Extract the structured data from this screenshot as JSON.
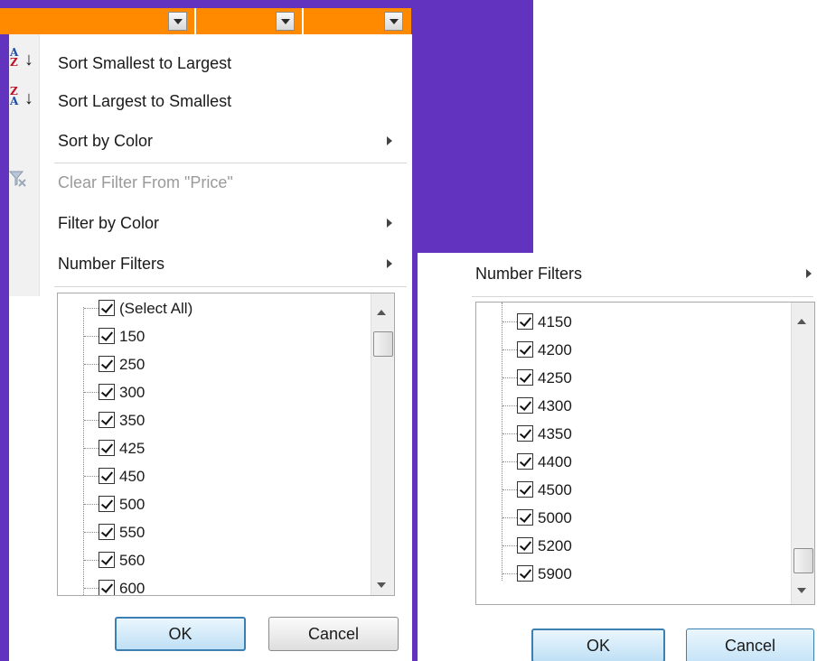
{
  "colors": {
    "background_purple": "#6233bf",
    "header_orange": "#ff8a00",
    "ok_border": "#3c7fb1"
  },
  "header": {
    "dropdown_icon": "chevron-down-icon"
  },
  "left_panel": {
    "menu": {
      "sort_asc": "Sort Smallest to Largest",
      "sort_desc": "Sort Largest to Smallest",
      "sort_color": "Sort by Color",
      "clear_filter": "Clear Filter From \"Price\"",
      "filter_color": "Filter by Color",
      "number_filters": "Number Filters"
    },
    "icons": {
      "asc": {
        "top": "A",
        "bottom": "Z"
      },
      "desc": {
        "top": "Z",
        "bottom": "A"
      }
    },
    "list": [
      "(Select All)",
      "150",
      "250",
      "300",
      "350",
      "425",
      "450",
      "500",
      "550",
      "560",
      "600"
    ],
    "ok": "OK",
    "cancel": "Cancel"
  },
  "right_panel": {
    "number_filters": "Number Filters",
    "list": [
      "4150",
      "4200",
      "4250",
      "4300",
      "4350",
      "4400",
      "4500",
      "5000",
      "5200",
      "5900"
    ],
    "ok": "OK",
    "cancel": "Cancel"
  }
}
